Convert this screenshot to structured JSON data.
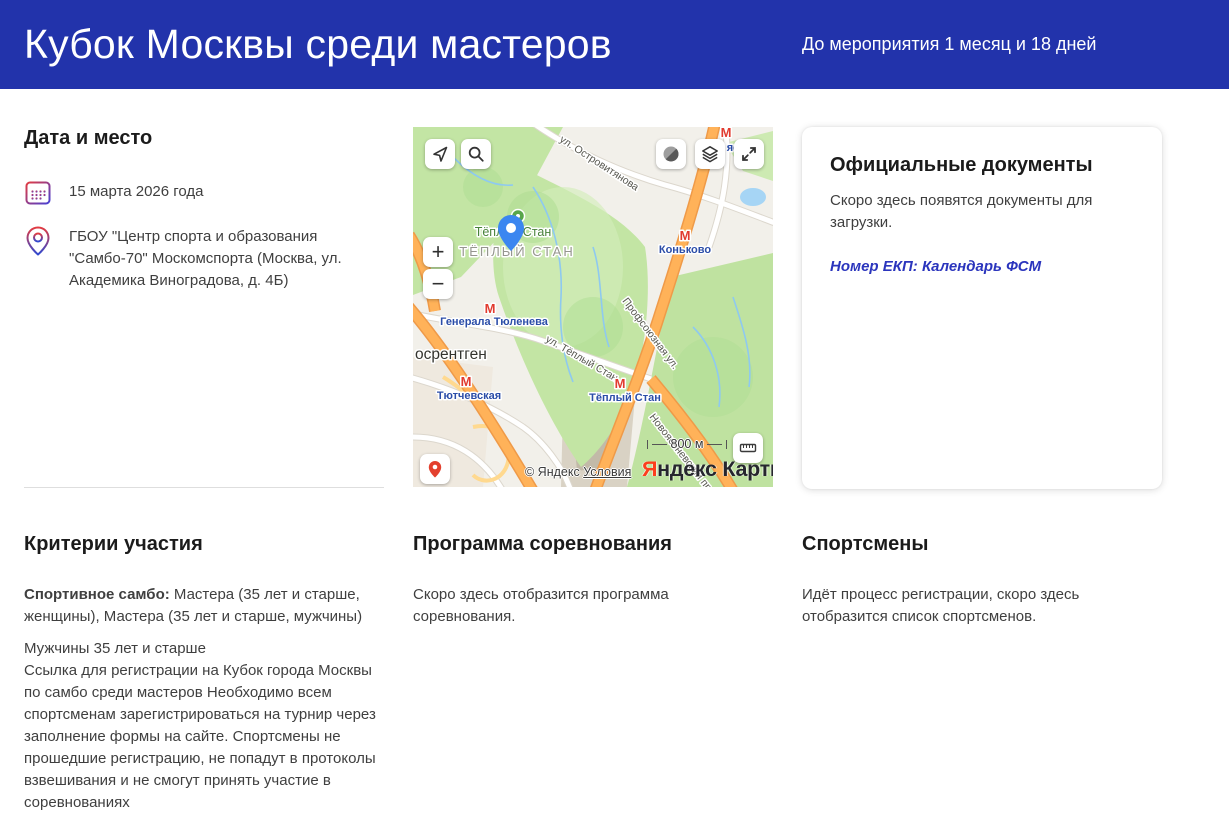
{
  "header": {
    "title": "Кубок Москвы среди мастеров",
    "countdown": "До мероприятия 1 месяц и 18 дней"
  },
  "date_place": {
    "heading": "Дата и место",
    "date": "15 марта 2026 года",
    "venue": "ГБОУ \"Центр спорта и образования \"Самбо-70\" Москомспорта (Москва, ул. Академика Виноградова, д. 4Б)"
  },
  "map": {
    "controls": {
      "zoom_in": "+",
      "zoom_out": "−"
    },
    "labels": {
      "metro_letter": "М",
      "street_ostrovityanova": "ул. Островитянова",
      "park_teply_stan": "Тёплый Стан",
      "district_teply_stan": "ТЁПЛЫЙ СТАН",
      "metro_konkovo": "Коньково",
      "metro_partial": "яе",
      "metro_gen_tyuleneva": "Генерала Тюленева",
      "metro_tyutchevskaya": "Тютчевская",
      "metro_teply_stan": "Тёплый Стан",
      "city_mosrentgen": "осрентген",
      "street_teply_stan": "ул. Тёплый Стан",
      "street_profsoyuznaya": "Профсоюзная ул.",
      "street_novoyasenevsky": "Новоясеневский пр."
    },
    "scale_label": "800 м",
    "copyright": "© Яндекс",
    "terms_link": "Условия",
    "logo_first": "Я",
    "logo_rest": "ндекс Карты"
  },
  "documents": {
    "heading": "Официальные документы",
    "text": "Скоро здесь появятся документы для загрузки.",
    "link": "Номер ЕКП: Календарь ФСМ"
  },
  "criteria": {
    "heading": "Критерии участия",
    "bold_label": "Спортивное самбо:",
    "bold_rest": "Мастера (35 лет и старше, женщины), Мастера (35 лет и старше, мужчины)",
    "para_line1": "Мужчины 35 лет и старше",
    "para_text": "Ссылка для регистрации на Кубок города Москвы по самбо среди мастеров Необходимо всем спортсменам зарегистрироваться на турнир через заполнение формы на сайте. Спортсмены не прошедшие регистрацию, не попадут в протоколы взвешивания и не смогут принять участие в соревнованиях"
  },
  "program": {
    "heading": "Программа соревнования",
    "text": "Скоро здесь отобразится программа соревнования."
  },
  "athletes": {
    "heading": "Спортсмены",
    "text": "Идёт процесс регистрации, скоро здесь отобразится список спортсменов."
  },
  "colors": {
    "header_bg": "#2233ab",
    "link_blue": "#2b35bd",
    "metro_red": "#e13b2f",
    "pin_blue": "#3b86f0",
    "map_green": "#c3e5a4"
  }
}
